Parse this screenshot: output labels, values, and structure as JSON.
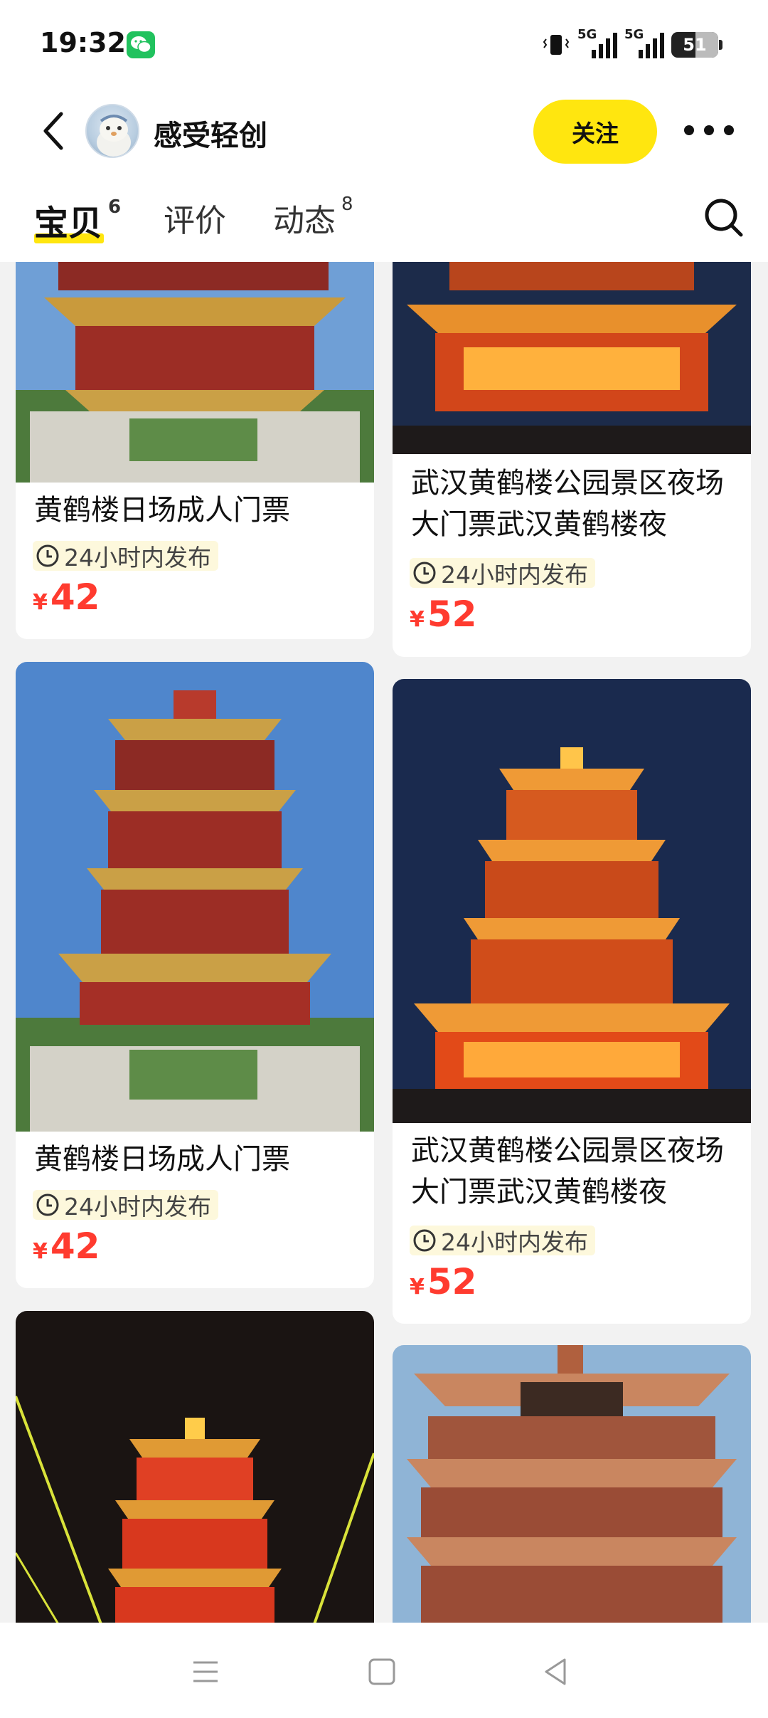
{
  "status_bar": {
    "time": "19:32",
    "battery": "51",
    "signal_label_1": "5G",
    "signal_label_2": "5G"
  },
  "header": {
    "shop_name": "感受轻创",
    "follow_label": "关注"
  },
  "tabs": [
    {
      "label": "宝贝",
      "count": "6"
    },
    {
      "label": "评价",
      "count": ""
    },
    {
      "label": "动态",
      "count": "8"
    }
  ],
  "items": [
    {
      "title": "黄鹤楼日场成人门票",
      "tag": "24小时内发布",
      "currency": "¥",
      "price": "42"
    },
    {
      "title": "武汉黄鹤楼公园景区夜场大门票武汉黄鹤楼夜",
      "tag": "24小时内发布",
      "currency": "¥",
      "price": "52"
    },
    {
      "title": "黄鹤楼日场成人门票",
      "tag": "24小时内发布",
      "currency": "¥",
      "price": "42"
    },
    {
      "title": "武汉黄鹤楼公园景区夜场大门票武汉黄鹤楼夜",
      "tag": "24小时内发布",
      "currency": "¥",
      "price": "52"
    }
  ],
  "colors": {
    "accent": "#ffe60f",
    "price": "#ff3b2f",
    "tag_bg": "#fdf8dc"
  }
}
